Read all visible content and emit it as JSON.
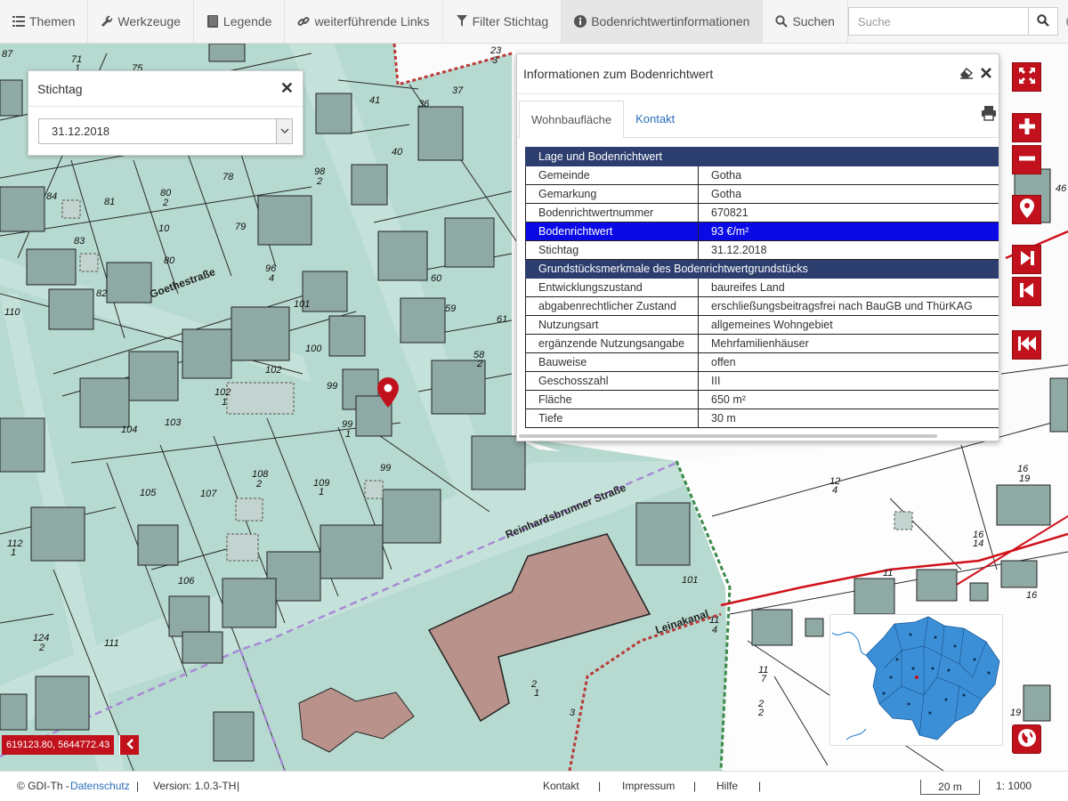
{
  "toolbar": {
    "items": [
      {
        "label": "Themen",
        "icon": "list-icon"
      },
      {
        "label": "Werkzeuge",
        "icon": "wrench-icon"
      },
      {
        "label": "Legende",
        "icon": "book-icon"
      },
      {
        "label": "weiterführende Links",
        "icon": "link-icon"
      },
      {
        "label": "Filter Stichtag",
        "icon": "filter-icon"
      },
      {
        "label": "Bodenrichtwertinformationen",
        "icon": "info-icon"
      },
      {
        "label": "Suchen",
        "icon": "search-icon"
      }
    ],
    "search_placeholder": "Suche"
  },
  "stichtag_panel": {
    "title": "Stichtag",
    "selected_date": "31.12.2018"
  },
  "info_window": {
    "title": "Informationen zum Bodenrichtwert",
    "tabs": [
      "Wohnbaufläche",
      "Kontakt"
    ],
    "active_tab": "Wohnbaufläche",
    "sections": [
      {
        "title": "Lage und Bodenrichtwert",
        "rows": [
          {
            "key": "Gemeinde",
            "value": "Gotha"
          },
          {
            "key": "Gemarkung",
            "value": "Gotha"
          },
          {
            "key": "Bodenrichtwertnummer",
            "value": "670821"
          },
          {
            "key": "Bodenrichtwert",
            "value": "93 €/m²",
            "highlight": true
          },
          {
            "key": "Stichtag",
            "value": "31.12.2018"
          }
        ]
      },
      {
        "title": "Grundstücksmerkmale des Bodenrichtwertgrundstücks",
        "rows": [
          {
            "key": "Entwicklungszustand",
            "value": "baureifes Land"
          },
          {
            "key": "abgabenrechtlicher Zustand",
            "value": "erschließungsbeitragsfrei nach BauGB und ThürKAG"
          },
          {
            "key": "Nutzungsart",
            "value": "allgemeines Wohngebiet"
          },
          {
            "key": "ergänzende Nutzungsangabe",
            "value": "Mehrfamilienhäuser"
          },
          {
            "key": "Bauweise",
            "value": "offen"
          },
          {
            "key": "Geschosszahl",
            "value": "III"
          },
          {
            "key": "Fläche",
            "value": "650 m²"
          },
          {
            "key": "Tiefe",
            "value": "30 m"
          }
        ]
      }
    ]
  },
  "map": {
    "street_labels": [
      "Goethestraße",
      "Reinhardsbrunner Straße",
      "Leinakanal"
    ],
    "parcel_labels": [
      "87",
      "71",
      "1",
      "75",
      "41",
      "37",
      "36",
      "40",
      "23",
      "3",
      "30",
      "84",
      "81",
      "80",
      "2",
      "78",
      "98",
      "96",
      "83",
      "79",
      "12",
      "10",
      "82",
      "80",
      "1",
      "96",
      "4",
      "60",
      "59",
      "110",
      "101",
      "100",
      "102",
      "102",
      "1",
      "103",
      "104",
      "105",
      "107",
      "108",
      "2",
      "109",
      "1",
      "99",
      "99",
      "1",
      "61",
      "58",
      "2",
      "112",
      "1",
      "106",
      "124",
      "2",
      "111",
      "12",
      "4",
      "16",
      "19",
      "11",
      "11",
      "4",
      "16",
      "14",
      "11",
      "7",
      "2",
      "2",
      "1",
      "3",
      "19",
      "46"
    ],
    "coordinates": "619123.80, 5644772.43",
    "colors": {
      "zone_fill": "#b6d9d0",
      "building_gray": "#8fa9a4",
      "building_brown": "#b9938b",
      "accent_red": "#c0111c",
      "boundary_red": "#d0101a",
      "boundary_purple": "#a88ad6"
    }
  },
  "controls": {
    "buttons": [
      "fullscreen-icon",
      "zoom-in-icon",
      "zoom-out-icon",
      "location-pin-icon",
      "next-icon",
      "previous-icon",
      "first-icon",
      "globe-icon"
    ]
  },
  "footer": {
    "copyright": "© GDI-Th - ",
    "privacy": "Datenschutz",
    "version": "Version: 1.0.3-TH",
    "links": [
      "Kontakt",
      "Impressum",
      "Hilfe"
    ],
    "scale_bar": "20 m",
    "scale": "1: 1000"
  }
}
